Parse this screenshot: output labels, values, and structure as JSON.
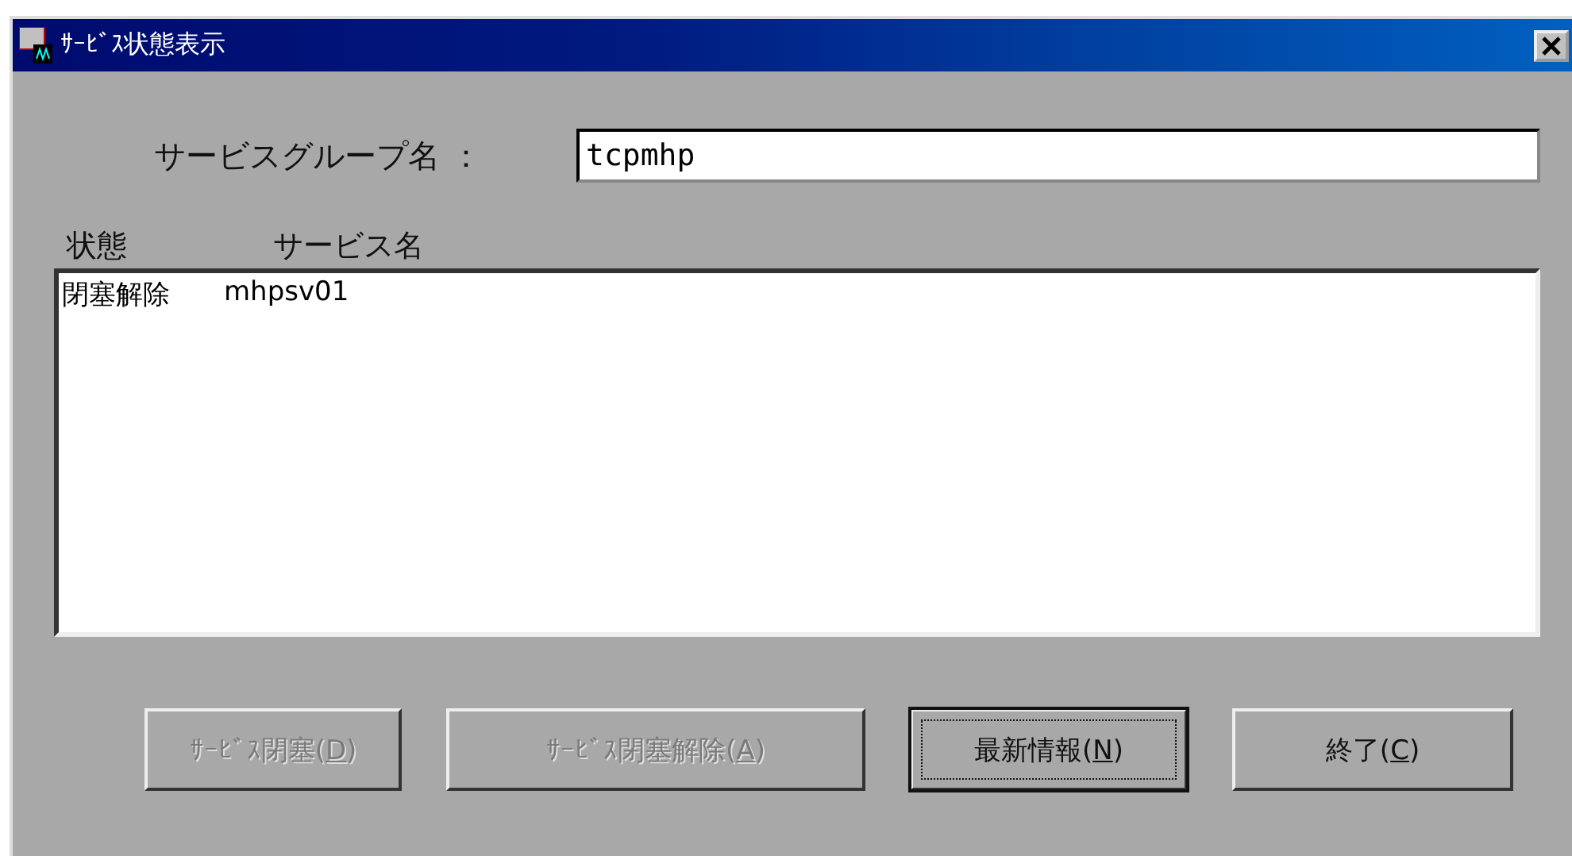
{
  "window": {
    "title": "ｻｰﾋﾞｽ状態表示"
  },
  "group": {
    "label": "サービスグループ名 ：",
    "value": "tcpmhp"
  },
  "list": {
    "columns": [
      "状態",
      "サービス名"
    ],
    "rows": [
      {
        "cells": [
          "閉塞解除",
          "mhpsv01"
        ]
      }
    ]
  },
  "buttons": [
    {
      "before": "ｻｰﾋﾞｽ閉塞(",
      "mnemonic": "D",
      "after": ")",
      "disabled": true,
      "default": false
    },
    {
      "before": "ｻｰﾋﾞｽ閉塞解除(",
      "mnemonic": "A",
      "after": ")",
      "disabled": true,
      "default": false
    },
    {
      "before": "最新情報(",
      "mnemonic": "N",
      "after": ")",
      "disabled": false,
      "default": true
    },
    {
      "before": "終了(",
      "mnemonic": "C",
      "after": ")",
      "disabled": false,
      "default": false
    }
  ]
}
